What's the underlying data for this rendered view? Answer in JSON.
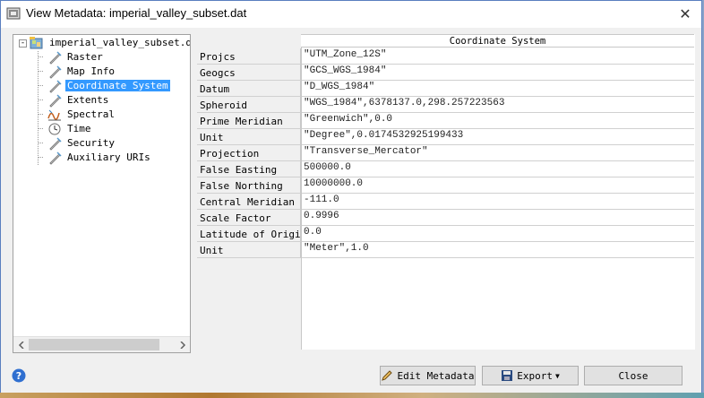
{
  "window": {
    "title": "View Metadata: imperial_valley_subset.dat",
    "close_glyph": "✕"
  },
  "tree": {
    "root": {
      "label": "imperial_valley_subset.dat",
      "icon": "raster-file-icon",
      "expander": "-"
    },
    "items": [
      {
        "label": "Raster",
        "icon": "metadata-page-icon"
      },
      {
        "label": "Map Info",
        "icon": "metadata-page-icon"
      },
      {
        "label": "Coordinate System",
        "icon": "metadata-page-icon",
        "selected": true
      },
      {
        "label": "Extents",
        "icon": "metadata-page-icon"
      },
      {
        "label": "Spectral",
        "icon": "spectral-icon"
      },
      {
        "label": "Time",
        "icon": "time-icon"
      },
      {
        "label": "Security",
        "icon": "metadata-page-icon"
      },
      {
        "label": "Auxiliary URIs",
        "icon": "metadata-page-icon"
      }
    ]
  },
  "grid": {
    "header": "Coordinate System",
    "rows": [
      {
        "name": "Projcs",
        "value": "\"UTM_Zone_12S\""
      },
      {
        "name": "Geogcs",
        "value": "\"GCS_WGS_1984\""
      },
      {
        "name": "Datum",
        "value": "\"D_WGS_1984\""
      },
      {
        "name": "Spheroid",
        "value": "\"WGS_1984\",6378137.0,298.257223563"
      },
      {
        "name": "Prime Meridian",
        "value": "\"Greenwich\",0.0"
      },
      {
        "name": "Unit",
        "value": "\"Degree\",0.0174532925199433"
      },
      {
        "name": "Projection",
        "value": "\"Transverse_Mercator\""
      },
      {
        "name": "False Easting",
        "value": "500000.0"
      },
      {
        "name": "False Northing",
        "value": "10000000.0"
      },
      {
        "name": "Central Meridian",
        "value": "-111.0"
      },
      {
        "name": "Scale Factor",
        "value": "0.9996"
      },
      {
        "name": "Latitude of Origin",
        "value": "0.0"
      },
      {
        "name": "Unit",
        "value": "\"Meter\",1.0"
      }
    ]
  },
  "buttons": {
    "edit_metadata": "Edit Metadata",
    "export": "Export",
    "close": "Close"
  },
  "colors": {
    "selection": "#3399ff",
    "window_border": "#5a7fbf"
  }
}
